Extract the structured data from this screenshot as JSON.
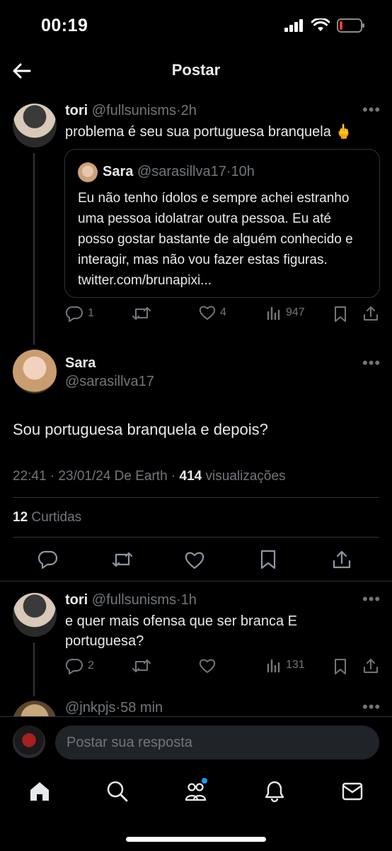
{
  "status": {
    "time": "00:19"
  },
  "header": {
    "title": "Postar"
  },
  "parent_post": {
    "name": "tori",
    "handle": "@fullsunisms",
    "sep": "·",
    "age": "2h",
    "text": "problema é seu sua portuguesa branquela 🖕",
    "quote": {
      "name": "Sara",
      "handle": "@sarasillva17",
      "sep": "·",
      "age": "10h",
      "text": "Eu não tenho ídolos e sempre achei estranho uma pessoa idolatrar outra pessoa. Eu até posso gostar bastante de alguém conhecido e interagir, mas não vou fazer estas figuras. twitter.com/brunapixi..."
    },
    "replies": "1",
    "likes": "4",
    "views": "947"
  },
  "main_post": {
    "name": "Sara",
    "handle": "@sarasillva17",
    "text": "Sou portuguesa branquela e depois?",
    "time": "22:41 · 23/01/24 De Earth · ",
    "views_count": "414",
    "views_label": " visualizações",
    "likes_count": "12",
    "likes_label": " Curtidas"
  },
  "reply_post": {
    "name": "tori",
    "handle": "@fullsunisms",
    "sep": "·",
    "age": "1h",
    "text": "e quer mais ofensa que ser branca E portuguesa?",
    "replies": "2",
    "views": "131"
  },
  "next_post": {
    "handle": "@jnkpjs",
    "sep": "·",
    "age": "58 min"
  },
  "composer": {
    "placeholder": "Postar sua resposta"
  },
  "colors": {
    "bg": "#000000",
    "text": "#e7e9ea",
    "muted": "#71767b",
    "divider": "#2f3336",
    "accent": "#1d9bf0"
  }
}
